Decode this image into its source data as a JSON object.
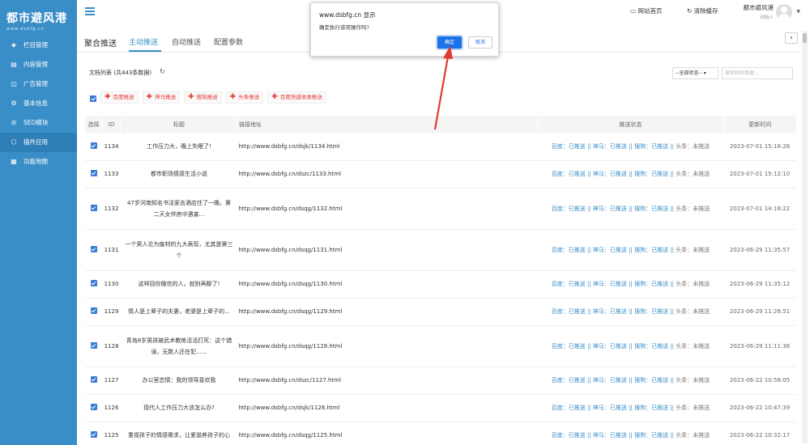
{
  "sidebar": {
    "logo_title": "都市避风港",
    "logo_sub": "www.dsbfg.cn",
    "items": [
      {
        "icon": "layers-icon",
        "glyph": "◈",
        "label": "栏目管理",
        "active": false
      },
      {
        "icon": "document-icon",
        "glyph": "▤",
        "label": "内容管理",
        "active": false
      },
      {
        "icon": "megaphone-icon",
        "glyph": "◫",
        "label": "广告管理",
        "active": false
      },
      {
        "icon": "gear-icon",
        "glyph": "⚙",
        "label": "基本信息",
        "active": false
      },
      {
        "icon": "seo-icon",
        "glyph": "⊘",
        "label": "SEO模块",
        "active": false
      },
      {
        "icon": "cube-icon",
        "glyph": "⬡",
        "label": "插件应用",
        "active": true
      },
      {
        "icon": "sitemap-icon",
        "glyph": "▦",
        "label": "功能地图",
        "active": false
      }
    ]
  },
  "topbar": {
    "site_home": "网站首页",
    "clear_cache": "清除缓存",
    "user_name": "都市避风港",
    "user_role": "创始人"
  },
  "tabs": {
    "main": "聚合推送",
    "items": [
      "主动推送",
      "自动推送",
      "配置参数"
    ],
    "active_index": 0
  },
  "list": {
    "title": "文档列表 (共443条数据)",
    "status_select": "--全部状态--",
    "search_placeholder": "搜索相关数据..."
  },
  "push_buttons": [
    "百度推送",
    "神马推送",
    "搜狗推送",
    "头条推送",
    "百度快速收录推送"
  ],
  "table": {
    "headers": [
      "选择",
      "ID",
      "标题",
      "链接地址",
      "推送状态",
      "更新时间"
    ],
    "status_text": {
      "pushed_part": "百度：已推送 || 神马：已推送 || 搜狗：已推送 || ",
      "unpushed_part": "头条：未推送"
    },
    "rows": [
      {
        "id": "1134",
        "title": "工作压力大，晚上失眠了!",
        "url": "http://www.dsbfg.cn/dsjk/1134.html",
        "time": "2023-07-01 15:16:26",
        "lines": 1
      },
      {
        "id": "1133",
        "title": "都市职场情感生活小说",
        "url": "http://www.dsbfg.cn/dszc/1133.html",
        "time": "2023-07-01 15:12:10",
        "lines": 1
      },
      {
        "id": "1132",
        "title": "47岁河南知名书法家去酒店住了一晚，第二天女伴房中遇害...",
        "url": "http://www.dsbfg.cn/dsqg/1132.html",
        "time": "2023-07-01 14:16:22",
        "lines": 2
      },
      {
        "id": "1131",
        "title": "一个男人沦为废材的九大表现，尤其是第三个",
        "url": "http://www.dsbfg.cn/dsqg/1131.html",
        "time": "2023-06-29 11:35:57",
        "lines": 2
      },
      {
        "id": "1130",
        "title": "这样回你微信的人，就别再聊了!",
        "url": "http://www.dsbfg.cn/dsqg/1130.html",
        "time": "2023-06-29 11:35:12",
        "lines": 1
      },
      {
        "id": "1129",
        "title": "情人是上辈子的夫妻，老婆是上辈子的...",
        "url": "http://www.dsbfg.cn/dsqg/1129.html",
        "time": "2023-06-29 11:26:51",
        "lines": 1
      },
      {
        "id": "1128",
        "title": "青岛8岁男孩被武术教练活活打死：这个错误，无数人还在犯......",
        "url": "http://www.dsbfg.cn/dsqg/1128.html",
        "time": "2023-06-29 11:11:36",
        "lines": 2
      },
      {
        "id": "1127",
        "title": "办公室恋情：我的领导喜欢我",
        "url": "http://www.dsbfg.cn/dszc/1127.html",
        "time": "2023-06-22 10:58:05",
        "lines": 1
      },
      {
        "id": "1126",
        "title": "现代人工作压力大该怎么办?",
        "url": "http://www.dsbfg.cn/dsjk/1126.html",
        "time": "2023-06-22 10:47:39",
        "lines": 1
      },
      {
        "id": "1125",
        "title": "重视孩子的情感需求，让爱滋养孩子的心",
        "url": "http://www.dsbfg.cn/dsqg/1125.html",
        "time": "2023-06-22 10:32:17",
        "lines": 1
      }
    ]
  },
  "dialog": {
    "title": "www.dsbfg.cn 显示",
    "message": "确定执行该项操作吗?",
    "ok": "确定",
    "cancel": "取消"
  },
  "colors": {
    "sidebar": "#3a8ec7",
    "accent": "#3a8ec7",
    "push_button_text": "#e53935",
    "annotation_arrow": "#e53935",
    "ok_button": "#1a73e8"
  }
}
